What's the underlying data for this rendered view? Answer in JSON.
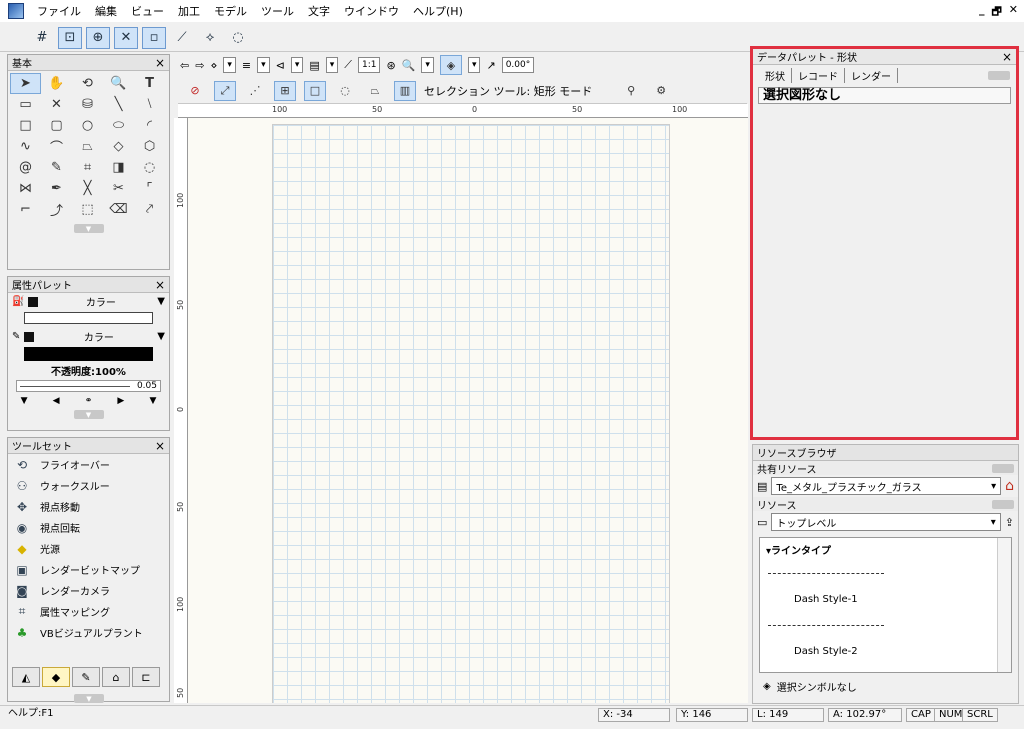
{
  "menu": [
    "ファイル",
    "編集",
    "ビュー",
    "加工",
    "モデル",
    "ツール",
    "文字",
    "ウインドウ",
    "ヘルプ(H)"
  ],
  "window_controls": [
    "_",
    "🗗",
    "✕"
  ],
  "basic_palette": {
    "title": "基本",
    "tools": [
      "arrow",
      "hand",
      "rotate-view",
      "zoom",
      "text",
      "callout",
      "x",
      "stack",
      "line",
      "line2",
      "rect",
      "rounded-rect",
      "circle",
      "oval",
      "arc",
      "freehand",
      "polygon-2d",
      "poly-tri",
      "poly-shape",
      "hexagon",
      "spiral",
      "eyedropper",
      "crop",
      "fill",
      "dots",
      "mirror",
      "pen",
      "cross",
      "scissors",
      "fillet",
      "corner",
      "curve",
      "select-box",
      "eraser",
      "extend"
    ]
  },
  "attribute_palette": {
    "title": "属性パレット",
    "fill_label": "カラー",
    "pen_label": "カラー",
    "opacity": "不透明度:100%",
    "thickness": "0.05"
  },
  "toolset_palette": {
    "title": "ツールセット",
    "items": [
      "フライオーバー",
      "ウォークスルー",
      "視点移動",
      "視点回転",
      "光源",
      "レンダービットマップ",
      "レンダーカメラ",
      "属性マッピング",
      "VBビジュアルプラント"
    ]
  },
  "view_bar": {
    "scale": "1:1",
    "angle": "0.00°",
    "mode_text": "セレクション ツール: 矩形 モード"
  },
  "rulers": {
    "top": [
      "100",
      "50",
      "0",
      "50",
      "100"
    ],
    "left": [
      "100",
      "50",
      "0",
      "50",
      "100",
      "50"
    ]
  },
  "data_palette": {
    "title": "データパレット - 形状",
    "tabs": [
      "形状",
      "レコード",
      "レンダー"
    ],
    "selection": "選択図形なし"
  },
  "resource_browser": {
    "title": "リソースブラウザ",
    "shared_label": "共有リソース",
    "shared_value": "Te_メタル_プラスチック_ガラス",
    "resource_label": "リソース",
    "resource_value": "トップレベル",
    "list_header": "ラインタイプ",
    "items": [
      "Dash Style-1",
      "Dash Style-2"
    ],
    "footer": "選択シンボルなし"
  },
  "status": {
    "help": "ヘルプ:F1",
    "x": "X: -34",
    "y": "Y: 146",
    "l": "L: 149",
    "a": "A: 102.97°",
    "cap": "CAP",
    "num": "NUM",
    "scrl": "SCRL"
  }
}
